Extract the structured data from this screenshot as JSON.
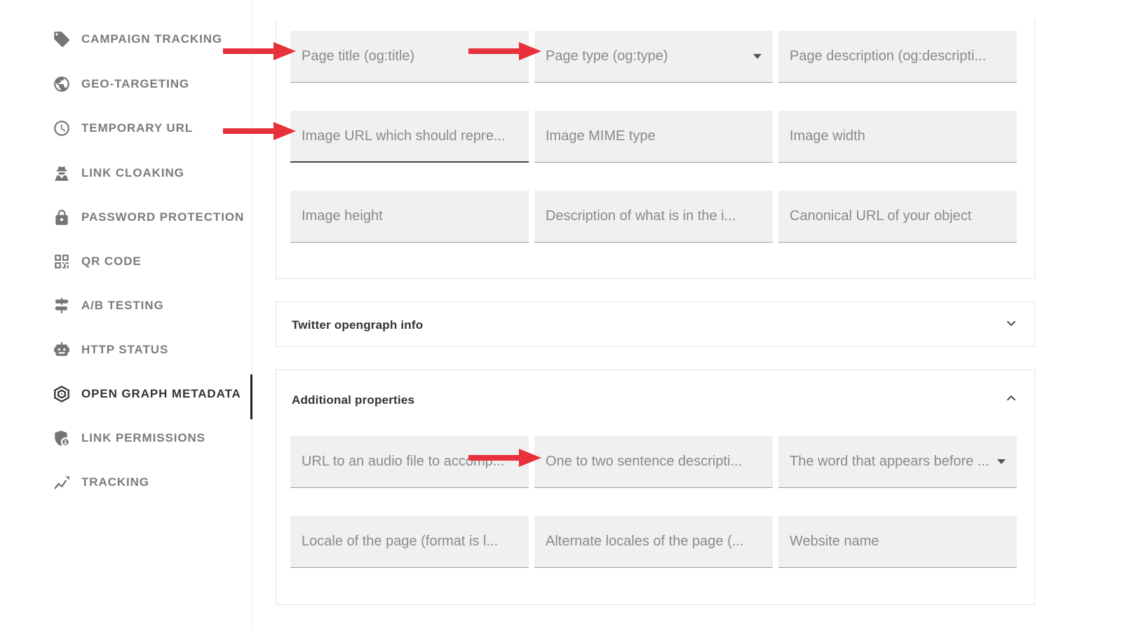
{
  "sidebar": {
    "items": [
      {
        "label": "CAMPAIGN TRACKING",
        "icon": "tag-icon"
      },
      {
        "label": "GEO-TARGETING",
        "icon": "globe-icon"
      },
      {
        "label": "TEMPORARY URL",
        "icon": "clock-icon"
      },
      {
        "label": "LINK CLOAKING",
        "icon": "spy-icon"
      },
      {
        "label": "PASSWORD PROTECTION",
        "icon": "lock-icon"
      },
      {
        "label": "QR CODE",
        "icon": "qr-code-icon"
      },
      {
        "label": "A/B TESTING",
        "icon": "signpost-icon"
      },
      {
        "label": "HTTP STATUS",
        "icon": "robot-icon"
      },
      {
        "label": "OPEN GRAPH METADATA",
        "icon": "spider-web-icon",
        "active": true
      },
      {
        "label": "LINK PERMISSIONS",
        "icon": "shield-user-icon"
      },
      {
        "label": "TRACKING",
        "icon": "trend-icon"
      }
    ]
  },
  "og_fields": {
    "page_title": "Page title (og:title)",
    "page_type": "Page type (og:type)",
    "page_description": "Page description (og:descripti...",
    "image_url": "Image URL which should repre...",
    "image_mime": "Image MIME type",
    "image_width": "Image width",
    "image_height": "Image height",
    "image_description": "Description of what is in the i...",
    "canonical_url": "Canonical URL of your object"
  },
  "twitter": {
    "title": "Twitter opengraph info"
  },
  "additional": {
    "title": "Additional properties",
    "audio_url": "URL to an audio file to accomp...",
    "description": "One to two sentence descripti...",
    "determiner": "The word that appears before ...",
    "locale": "Locale of the page (format is l...",
    "alternate_locales": "Alternate locales of the page (...",
    "site_name": "Website name"
  },
  "colors": {
    "arrow": "#e8313a",
    "field_bg": "#f0f0f0",
    "active_text": "#333333",
    "inactive_text": "#7b7b7b"
  }
}
